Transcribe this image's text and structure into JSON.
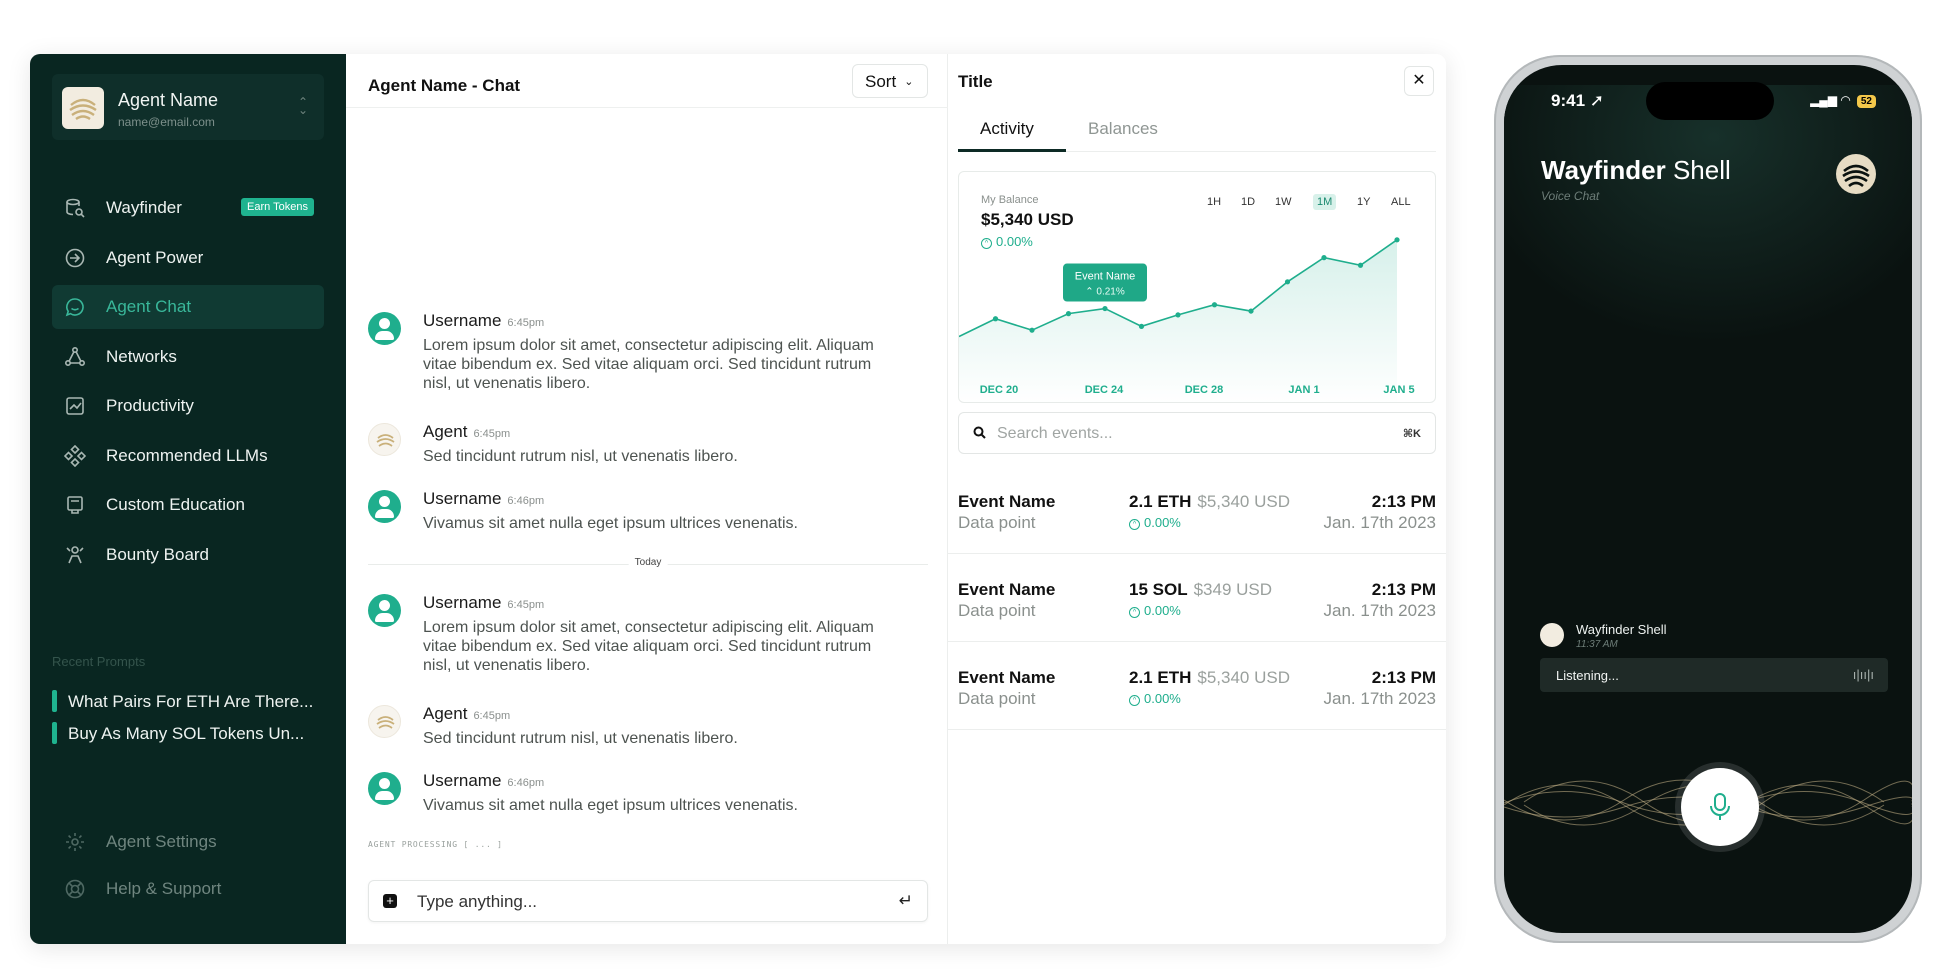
{
  "account": {
    "name": "Agent Name",
    "email": "name@email.com"
  },
  "nav": [
    {
      "label": "Wayfinder",
      "badge": "Earn Tokens",
      "icon": "database-search-icon"
    },
    {
      "label": "Agent Power",
      "icon": "login-arrow-icon"
    },
    {
      "label": "Agent Chat",
      "icon": "chat-bubble-icon",
      "active": true
    },
    {
      "label": "Networks",
      "icon": "network-icon"
    },
    {
      "label": "Productivity",
      "icon": "chart-box-icon"
    },
    {
      "label": "Recommended LLMs",
      "icon": "diamond-nodes-icon"
    },
    {
      "label": "Custom Education",
      "icon": "book-screen-icon"
    },
    {
      "label": "Bounty Board",
      "icon": "target-person-icon"
    }
  ],
  "recent": {
    "title": "Recent Prompts",
    "items": [
      "What Pairs For ETH Are There...",
      "Buy As Many SOL Tokens Un..."
    ]
  },
  "footer": {
    "settings": "Agent Settings",
    "help": "Help & Support"
  },
  "chat": {
    "title": "Agent Name - Chat",
    "sort_label": "Sort",
    "today_label": "Today",
    "processing": "AGENT PROCESSING [ ... ]",
    "input_placeholder": "Type anything...",
    "messages_before": [
      {
        "who": "Username",
        "time": "6:45pm",
        "type": "user",
        "text": "Lorem ipsum dolor sit amet, consectetur adipiscing elit. Aliquam vitae bibendum ex. Sed vitae aliquam orci. Sed tincidunt rutrum nisl, ut venenatis libero."
      },
      {
        "who": "Agent",
        "time": "6:45pm",
        "type": "agent",
        "text": "Sed tincidunt rutrum nisl, ut venenatis libero."
      },
      {
        "who": "Username",
        "time": "6:46pm",
        "type": "user",
        "text": "Vivamus sit amet nulla eget ipsum ultrices venenatis."
      }
    ],
    "messages_after": [
      {
        "who": "Username",
        "time": "6:45pm",
        "type": "user",
        "text": "Lorem ipsum dolor sit amet, consectetur adipiscing elit. Aliquam vitae bibendum ex. Sed vitae aliquam orci. Sed tincidunt rutrum nisl, ut venenatis libero."
      },
      {
        "who": "Agent",
        "time": "6:45pm",
        "type": "agent",
        "text": "Sed tincidunt rutrum nisl, ut venenatis libero."
      },
      {
        "who": "Username",
        "time": "6:46pm",
        "type": "user",
        "text": "Vivamus sit amet nulla eget ipsum ultrices venenatis."
      }
    ]
  },
  "activity": {
    "title": "Title",
    "tabs": [
      "Activity",
      "Balances"
    ],
    "balance_label": "My Balance",
    "balance": "$5,340 USD",
    "balance_change": "0.00%",
    "ranges": [
      "1H",
      "1D",
      "1W",
      "1M",
      "1Y",
      "ALL"
    ],
    "active_range": "1M",
    "tooltip": {
      "name": "Event Name",
      "change": "0.21%"
    },
    "search_placeholder": "Search events...",
    "search_shortcut": "⌘K",
    "events": [
      {
        "name": "Event Name",
        "sub": "Data point",
        "amount": "2.1 ETH",
        "usd": "$5,340 USD",
        "change": "0.00%",
        "time": "2:13 PM",
        "date": "Jan. 17th 2023"
      },
      {
        "name": "Event Name",
        "sub": "Data point",
        "amount": "15 SOL",
        "usd": "$349 USD",
        "change": "0.00%",
        "time": "2:13 PM",
        "date": "Jan. 17th 2023"
      },
      {
        "name": "Event Name",
        "sub": "Data point",
        "amount": "2.1 ETH",
        "usd": "$5,340 USD",
        "change": "0.00%",
        "time": "2:13 PM",
        "date": "Jan. 17th 2023"
      }
    ]
  },
  "chart_data": {
    "type": "area",
    "x_ticks": [
      "DEC 20",
      "DEC 24",
      "DEC 28",
      "JAN 1",
      "JAN 5"
    ],
    "values": [
      20,
      34,
      25,
      38,
      42,
      28,
      37,
      45,
      40,
      63,
      82,
      76,
      96
    ],
    "ylim": [
      0,
      110
    ],
    "color": "#1fae8d"
  },
  "phone": {
    "time": "9:41",
    "battery": "52",
    "title_bold": "Wayfinder",
    "title_rest": " Shell",
    "subtitle": "Voice Chat",
    "msg_name": "Wayfinder Shell",
    "msg_time": "11:37 AM",
    "listening": "Listening..."
  }
}
